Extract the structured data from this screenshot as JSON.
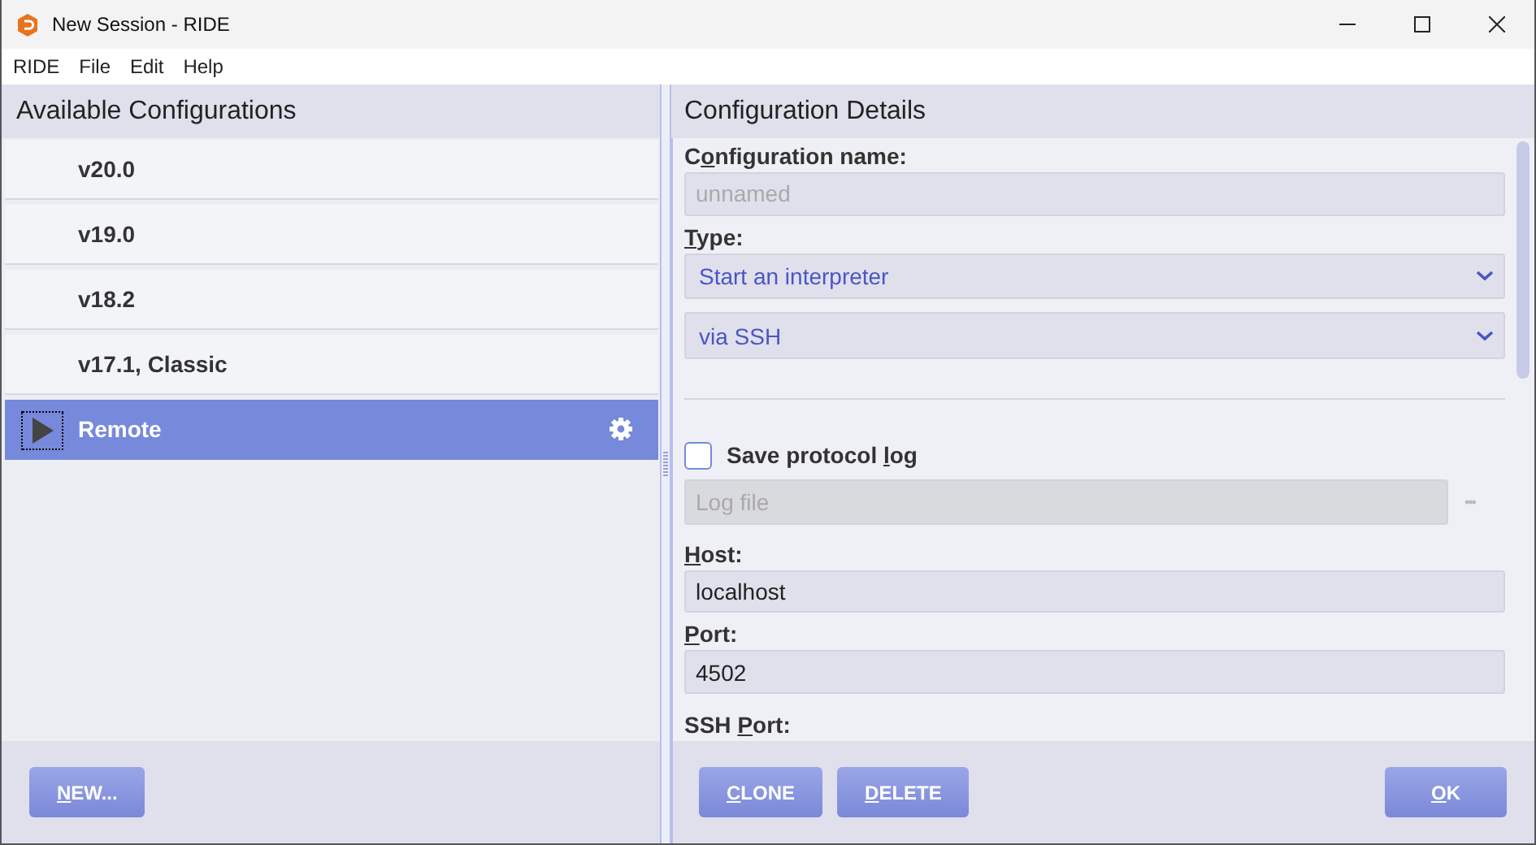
{
  "window": {
    "title": "New Session - RIDE"
  },
  "menu": [
    {
      "label": "RIDE"
    },
    {
      "label": "File"
    },
    {
      "label": "Edit"
    },
    {
      "label": "Help"
    }
  ],
  "configurations": {
    "title": "Available Configurations",
    "items": [
      {
        "label": "v20.0",
        "selected": false
      },
      {
        "label": "v19.0",
        "selected": false
      },
      {
        "label": "v18.2",
        "selected": false
      },
      {
        "label": "v17.1, Classic",
        "selected": false
      },
      {
        "label": "Remote",
        "selected": true
      }
    ],
    "new_button": {
      "label": {
        "key": "N",
        "after": "EW..."
      }
    }
  },
  "details": {
    "title": "Configuration Details",
    "fields": [
      {
        "kind": "text",
        "label": {
          "before": "C",
          "key": "o",
          "after": "nfiguration name:"
        },
        "placeholder": "unnamed"
      },
      {
        "kind": "select",
        "label": {
          "key": "T",
          "after": "ype:"
        },
        "value": "Start an interpreter"
      },
      {
        "kind": "select",
        "value": "via SSH"
      },
      {
        "kind": "rule"
      },
      {
        "kind": "checkbox",
        "label": {
          "before": "Save protocol ",
          "key": "l",
          "after": "og"
        },
        "checked": false
      },
      {
        "kind": "file",
        "placeholder": "Log file",
        "button": "•••",
        "disabled": true
      },
      {
        "kind": "text",
        "label": {
          "key": "H",
          "after": "ost:"
        },
        "value": "localhost"
      },
      {
        "kind": "text",
        "label": {
          "key": "P",
          "after": "ort:"
        },
        "value": "4502"
      },
      {
        "kind": "label",
        "label": {
          "before": "SSH ",
          "key": "P",
          "after": "ort:"
        }
      }
    ],
    "buttons": [
      {
        "label": {
          "key": "C",
          "after": "LONE"
        }
      },
      {
        "label": {
          "key": "D",
          "after": "ELETE"
        }
      },
      {
        "label": {
          "key": "O",
          "after": "K"
        }
      }
    ]
  }
}
